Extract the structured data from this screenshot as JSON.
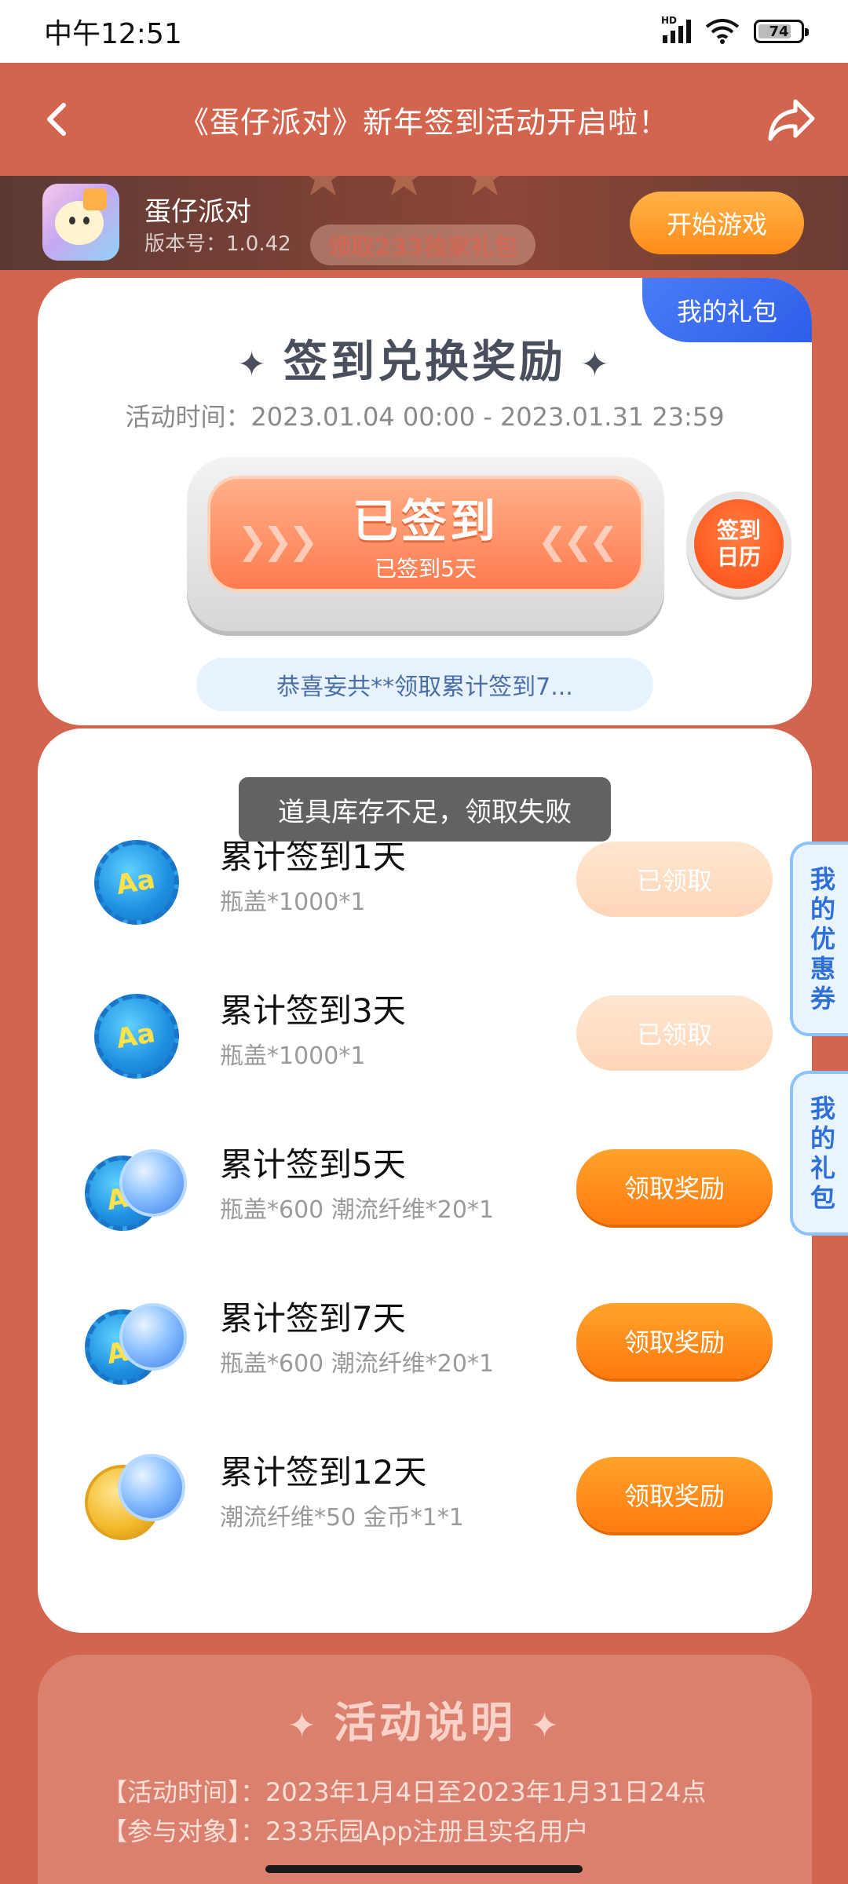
{
  "status_bar": {
    "time": "中午12:51",
    "battery": "74",
    "signal_tag": "HD"
  },
  "header": {
    "title": "《蛋仔派对》新年签到活动开启啦！"
  },
  "game": {
    "name": "蛋仔派对",
    "version": "版本号：1.0.42",
    "start_button": "开始游戏",
    "banner_deco_text": "领取233独家礼包"
  },
  "signin_card": {
    "my_gift_tab": "我的礼包",
    "title": "签到兑换奖励",
    "activity_time": "活动时间：2023.01.04 00:00 - 2023.01.31 23:59",
    "signin_main": "已签到",
    "signin_sub": "已签到5天",
    "calendar_button_line1": "签到",
    "calendar_button_line2": "日历",
    "marquee": "恭喜妄共**领取累计签到7..."
  },
  "toast": "道具库存不足，领取失败",
  "rewards": [
    {
      "title": "累计签到1天",
      "desc": "瓶盖*1000*1",
      "button": "已领取",
      "state": "claimed",
      "icon": "bottle-cap-icon"
    },
    {
      "title": "累计签到3天",
      "desc": "瓶盖*1000*1",
      "button": "已领取",
      "state": "claimed",
      "icon": "bottle-cap-icon"
    },
    {
      "title": "累计签到5天",
      "desc": "瓶盖*600 潮流纤维*20*1",
      "button": "领取奖励",
      "state": "active",
      "icon": "cap-and-fiber-icon"
    },
    {
      "title": "累计签到7天",
      "desc": "瓶盖*600 潮流纤维*20*1",
      "button": "领取奖励",
      "state": "active",
      "icon": "cap-and-fiber-icon"
    },
    {
      "title": "累计签到12天",
      "desc": "潮流纤维*50 金币*1*1",
      "button": "领取奖励",
      "state": "active",
      "icon": "coin-and-fiber-icon"
    }
  ],
  "side_tabs": {
    "coupon": [
      "我",
      "的",
      "优",
      "惠",
      "券"
    ],
    "gift": [
      "我",
      "的",
      "礼",
      "包"
    ]
  },
  "rules": {
    "title": "活动说明",
    "lines": [
      "【活动时间】：2023年1月4日至2023年1月31日24点",
      "【参与对象】：233乐园App注册且实名用户"
    ]
  },
  "colors": {
    "background": "#d3654f",
    "accent_orange": "#ff7a0e",
    "accent_blue": "#2f5ee8"
  }
}
